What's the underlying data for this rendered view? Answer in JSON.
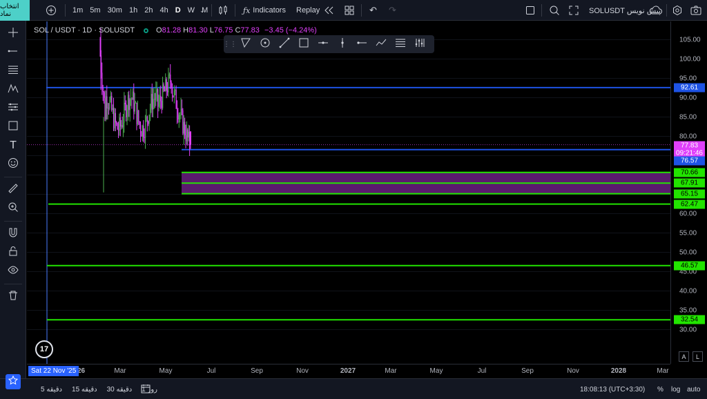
{
  "topbar": {
    "symbol_button": "انتخاب نماد",
    "intervals": [
      "1m",
      "5m",
      "30m",
      "1h",
      "2h",
      "4h",
      "D",
      "W",
      "M"
    ],
    "active_interval": "D",
    "indicators_label": "Indicators",
    "replay_label": "Replay",
    "layout_name": "SOLUSDT پیش نویس"
  },
  "legend": {
    "symbol": "SOL / USDT · 1D · SOLUSDT",
    "open_key": "O",
    "open": "81.28",
    "high_key": "H",
    "high": "81.30",
    "low_key": "L",
    "low": "76.75",
    "close_key": "C",
    "close": "77.83",
    "change": "−3.45 (−4.24%)"
  },
  "price_axis": {
    "ticks": [
      "105.00",
      "100.00",
      "95.00",
      "90.00",
      "85.00",
      "80.00",
      "60.00",
      "55.00",
      "50.00",
      "45.00",
      "40.00",
      "35.00",
      "30.00"
    ],
    "labels": [
      {
        "text": "92.61",
        "bg": "#1e53e5",
        "fg": "#ffffff"
      },
      {
        "text": "77.83",
        "bg": "#e040fb",
        "fg": "#ffffff"
      },
      {
        "text": "09:21:46",
        "bg": "#e040fb",
        "fg": "#ffffff"
      },
      {
        "text": "76.57",
        "bg": "#1e53e5",
        "fg": "#ffffff"
      },
      {
        "text": "70.66",
        "bg": "#22e400",
        "fg": "#000000"
      },
      {
        "text": "67.91",
        "bg": "#22e400",
        "fg": "#000000"
      },
      {
        "text": "65.15",
        "bg": "#22e400",
        "fg": "#000000"
      },
      {
        "text": "62.47",
        "bg": "#22e400",
        "fg": "#000000"
      },
      {
        "text": "46.57",
        "bg": "#22e400",
        "fg": "#000000"
      },
      {
        "text": "32.54",
        "bg": "#22e400",
        "fg": "#000000"
      }
    ]
  },
  "time_axis": {
    "cursor_label": "Sat 22 Nov '25",
    "ticks": [
      "2026",
      "Mar",
      "May",
      "Jul",
      "Sep",
      "Nov",
      "2027",
      "Mar",
      "May",
      "Jul",
      "Sep",
      "Nov",
      "2028",
      "Mar"
    ],
    "auto_btn": "A",
    "log_btn": "L"
  },
  "bottombar": {
    "ranges": [
      "5 دقیقه",
      "15 دقیقه",
      "30 دقیقه",
      "1 روز"
    ],
    "clock": "18:08:13 (UTC+3:30)",
    "percent": "%",
    "log": "log",
    "auto": "auto"
  },
  "logo": "17",
  "colors": {
    "blue_line": "#1e53e5",
    "green_line": "#22e400",
    "zone_fill": "#5a1a6e",
    "candle_up": "#4caf50",
    "candle_down": "#e040fb",
    "accent": "#2962ff"
  },
  "chart_data": {
    "type": "candlestick",
    "symbol": "SOL / USDT",
    "interval": "1D",
    "last_ohlc": {
      "open": 81.28,
      "high": 81.3,
      "low": 76.75,
      "close": 77.83
    },
    "ylim": [
      25,
      108
    ],
    "horizontal_levels": [
      {
        "price": 92.61,
        "color": "blue"
      },
      {
        "price": 76.57,
        "color": "blue"
      },
      {
        "price": 70.66,
        "color": "green"
      },
      {
        "price": 67.91,
        "color": "green"
      },
      {
        "price": 65.15,
        "color": "green"
      },
      {
        "price": 62.47,
        "color": "green"
      },
      {
        "price": 46.57,
        "color": "green"
      },
      {
        "price": 32.54,
        "color": "green"
      }
    ],
    "zone": {
      "from": 65.15,
      "to": 70.66
    },
    "current_price": 77.83
  }
}
